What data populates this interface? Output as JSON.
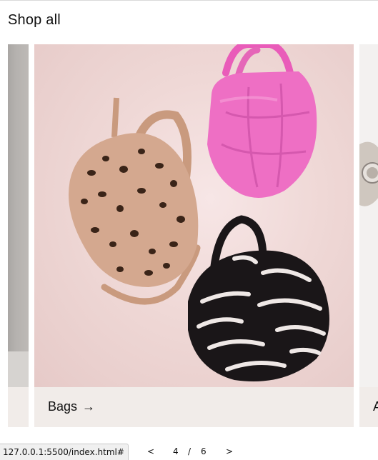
{
  "section": {
    "title": "Shop all"
  },
  "cards": {
    "main": {
      "label": "Bags",
      "arrow": "→"
    },
    "next": {
      "label": "A"
    }
  },
  "status_bar": {
    "url": "127.0.0.1:5500/index.html#"
  },
  "pager": {
    "prev": "<",
    "current": "4",
    "separator": "/",
    "total": "6",
    "next": ">"
  },
  "colors": {
    "card_bg": "#f1ece9",
    "image_bg": "#efd8d6",
    "pink_bag": "#ee6fc4",
    "leopard_bag": "#c99a7e",
    "zebra_bag": "#1a1618"
  },
  "icons": {
    "arrow": "right-arrow-icon"
  }
}
